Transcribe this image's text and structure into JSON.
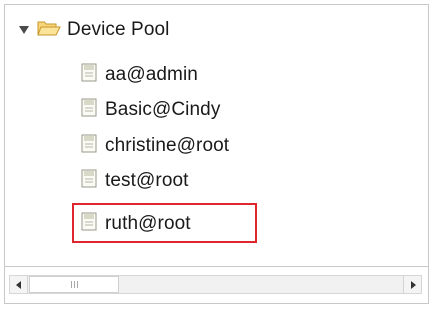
{
  "tree": {
    "root_label": "Device Pool",
    "children": [
      {
        "label": "aa@admin"
      },
      {
        "label": "Basic@Cindy"
      },
      {
        "label": "christine@root"
      },
      {
        "label": "test@root"
      },
      {
        "label": "ruth@root"
      }
    ],
    "selected_index": 4
  },
  "icons": {
    "expander": "triangle-down-icon",
    "root": "open-folder-icon",
    "child": "document-icon",
    "scroll_left": "arrow-left-icon",
    "scroll_right": "arrow-right-icon"
  },
  "colors": {
    "highlight_border": "#e0262d",
    "folder_fill": "#f7d77a",
    "folder_stroke": "#c7962a"
  }
}
